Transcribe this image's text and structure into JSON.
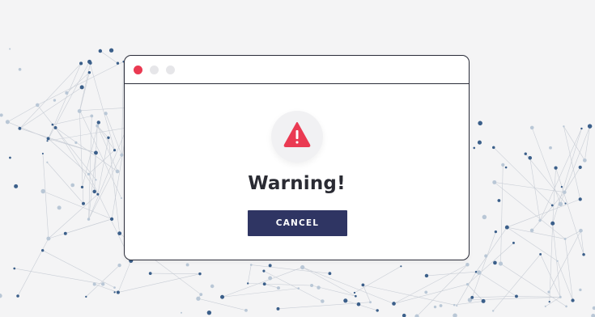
{
  "dialog": {
    "title": "Warning!",
    "cancel_label": "CANCEL",
    "icon": "warning-triangle-icon"
  },
  "window_controls": {
    "close_color": "#ea3a52",
    "inactive_color": "#e6e6e9"
  },
  "colors": {
    "accent_red": "#ea3a52",
    "button_navy": "#2f3563",
    "network_dark": "#3b5f8a",
    "network_light": "#b9c7d6"
  }
}
